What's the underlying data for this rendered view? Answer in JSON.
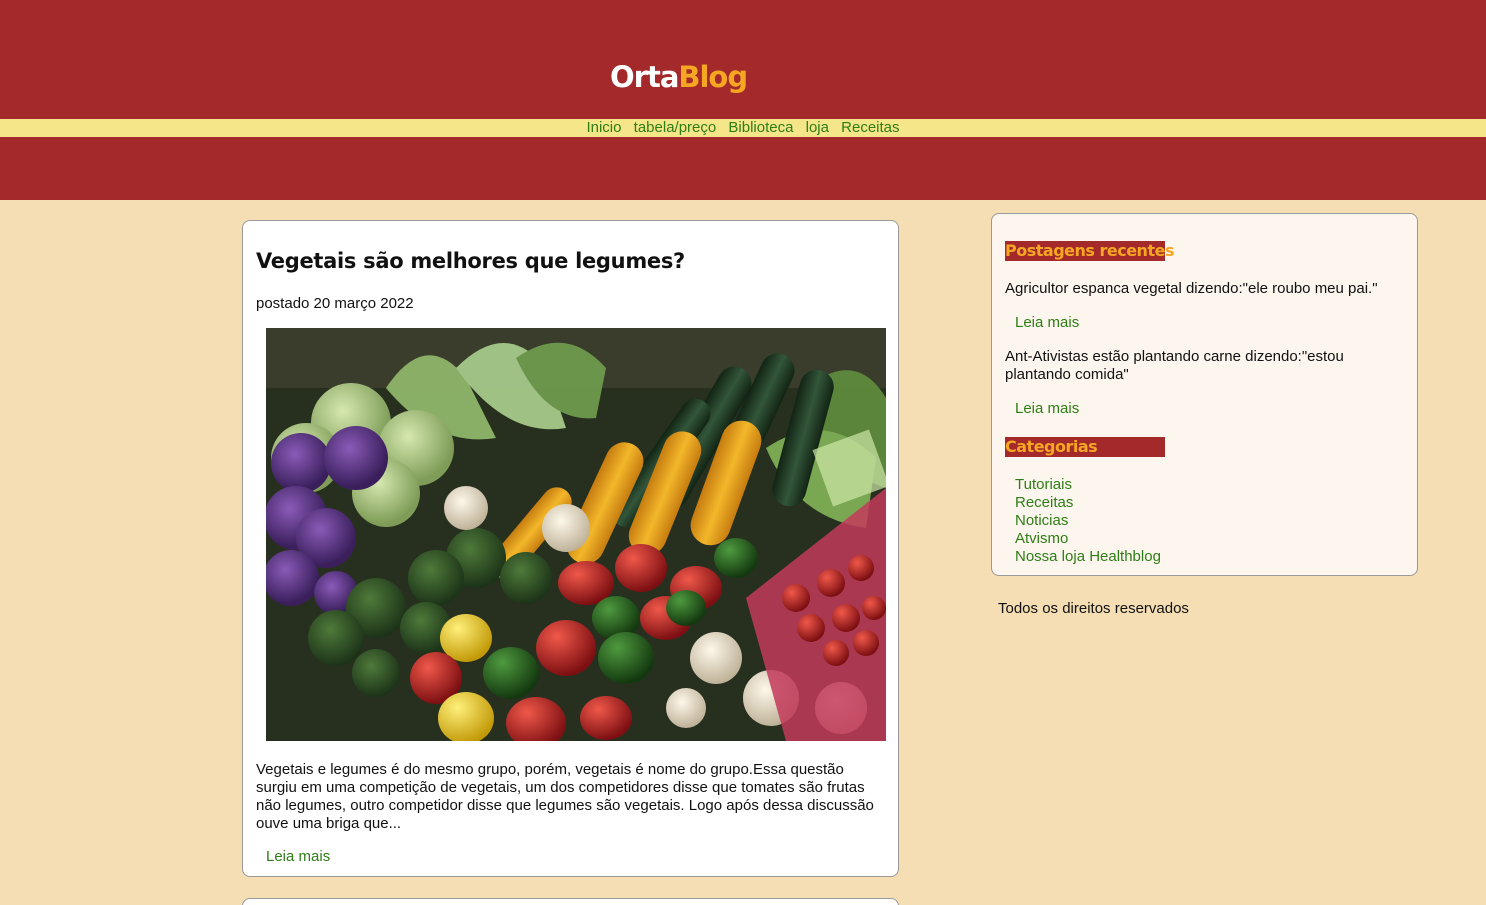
{
  "brand": {
    "part1": "Orta",
    "part2": "Blog",
    "color1": "#ffffff",
    "color2": "#f5a623"
  },
  "nav": {
    "items": [
      "Inicio",
      "tabela/preço",
      "Biblioteca",
      "loja",
      "Receitas"
    ]
  },
  "post": {
    "title": "Vegetais são melhores que legumes?",
    "date": "postado 20 março 2022",
    "excerpt": "Vegetais e legumes é do mesmo grupo, porém, vegetais é nome do grupo.Essa questão surgiu em uma competição de vegetais, um dos competidores disse que tomates são frutas não legumes, outro competidor disse que legumes são vegetais. Logo após dessa discussão ouve uma briga que...",
    "read_more": "Leia mais"
  },
  "sidebar": {
    "recent_heading": "Postagens recentes",
    "recent": [
      {
        "text": "Agricultor espanca vegetal dizendo:\"ele roubo meu pai.\"",
        "link": "Leia mais"
      },
      {
        "text": "Ant-Ativistas estão plantando carne dizendo:\"estou plantando comida\"",
        "link": "Leia mais"
      }
    ],
    "categories_heading": "Categorias",
    "categories": [
      "Tutoriais",
      "Receitas",
      "Noticias",
      "Atvismo",
      "Nossa loja Healthblog"
    ]
  },
  "footer": {
    "rights": "Todos os direitos reservados"
  },
  "colors": {
    "header_bg": "#a4292b",
    "nav_bg": "#f5e68a",
    "page_bg": "#f5deb3",
    "link": "#2e7d16",
    "accent": "#f5a623"
  }
}
